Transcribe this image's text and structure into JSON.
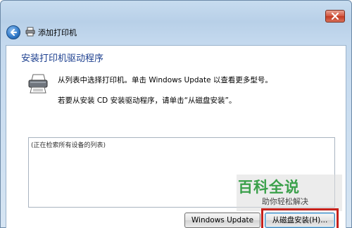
{
  "window": {
    "title": "添加打印机"
  },
  "main": {
    "heading": "安装打印机驱动程序",
    "instruction_1": "从列表中选择打印机。单击 Windows Update 以查看更多型号。",
    "instruction_2": "若要从安装 CD 安装驱动程序，请单击“从磁盘安装”。",
    "list_status": "(正在检索所有设备的列表)"
  },
  "buttons": {
    "windows_update": "Windows Update",
    "have_disk": "从磁盘安装(H)..."
  },
  "watermark": {
    "main": "百科全说",
    "sub": "助你轻松解决"
  },
  "icons": {
    "close": "close-icon",
    "back": "back-arrow-icon",
    "title_printer": "printer-icon",
    "big_printer": "printer-icon"
  },
  "colors": {
    "heading": "#1c3f8f",
    "close_button": "#d2553e",
    "highlight": "#c6211b",
    "watermark": "#3aa04a"
  }
}
